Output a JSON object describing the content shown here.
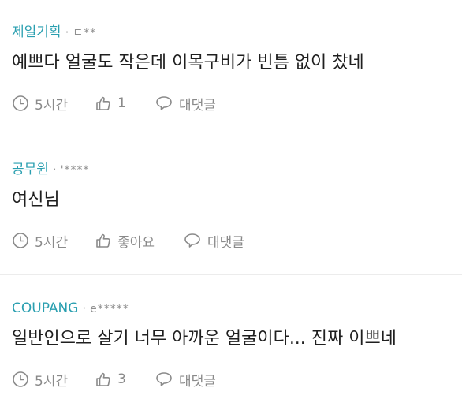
{
  "comments": [
    {
      "company": "제일기획",
      "user": "ㅌ**",
      "text": "예쁘다 얼굴도 작은데 이목구비가 빈틈 없이 찼네",
      "time": "5시간",
      "likes": "1",
      "reply_label": "대댓글"
    },
    {
      "company": "공무원",
      "user": "'****",
      "text": "여신님",
      "time": "5시간",
      "likes": "좋아요",
      "reply_label": "대댓글"
    },
    {
      "company": "COUPANG",
      "user": "e*****",
      "text": "일반인으로 살기 너무 아까운 얼굴이다... 진짜 이쁘네",
      "time": "5시간",
      "likes": "3",
      "reply_label": "대댓글"
    }
  ],
  "separator": "·",
  "colors": {
    "company": "#2a9fb0",
    "meta_gray": "#8a8a8a",
    "divider": "#ececec"
  },
  "icons": {
    "time": "clock-icon",
    "like": "thumbs-up-icon",
    "reply": "speech-bubble-icon"
  }
}
